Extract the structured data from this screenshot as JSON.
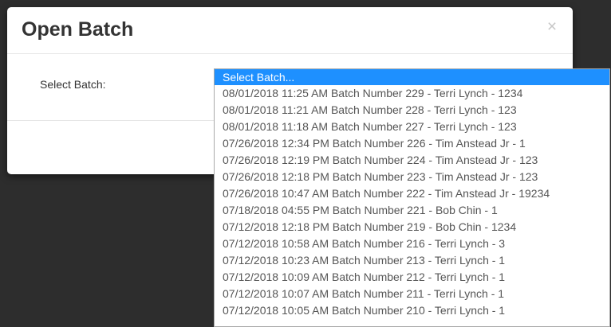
{
  "modal": {
    "title": "Open Batch",
    "close_symbol": "×",
    "select_label": "Select Batch:"
  },
  "dropdown": {
    "selected_index": 0,
    "highlight_color": "#1e90ff",
    "options": [
      "Select Batch...",
      "08/01/2018 11:25 AM Batch Number 229 - Terri Lynch - 1234",
      "08/01/2018 11:21 AM Batch Number 228 - Terri Lynch - 123",
      "08/01/2018 11:18 AM Batch Number 227 - Terri Lynch - 123",
      "07/26/2018 12:34 PM Batch Number 226 - Tim Anstead Jr - 1",
      "07/26/2018 12:19 PM Batch Number 224 - Tim Anstead Jr - 123",
      "07/26/2018 12:18 PM Batch Number 223 - Tim Anstead Jr - 123",
      "07/26/2018 10:47 AM Batch Number 222 - Tim Anstead Jr - 19234",
      "07/18/2018 04:55 PM Batch Number 221 - Bob Chin - 1",
      "07/12/2018 12:18 PM Batch Number 219 - Bob Chin - 1234",
      "07/12/2018 10:58 AM Batch Number 216 - Terri Lynch - 3",
      "07/12/2018 10:23 AM Batch Number 213 - Terri Lynch - 1",
      "07/12/2018 10:09 AM Batch Number 212 - Terri Lynch - 1",
      "07/12/2018 10:07 AM Batch Number 211 - Terri Lynch - 1",
      "07/12/2018 10:05 AM Batch Number 210 - Terri Lynch - 1"
    ]
  }
}
